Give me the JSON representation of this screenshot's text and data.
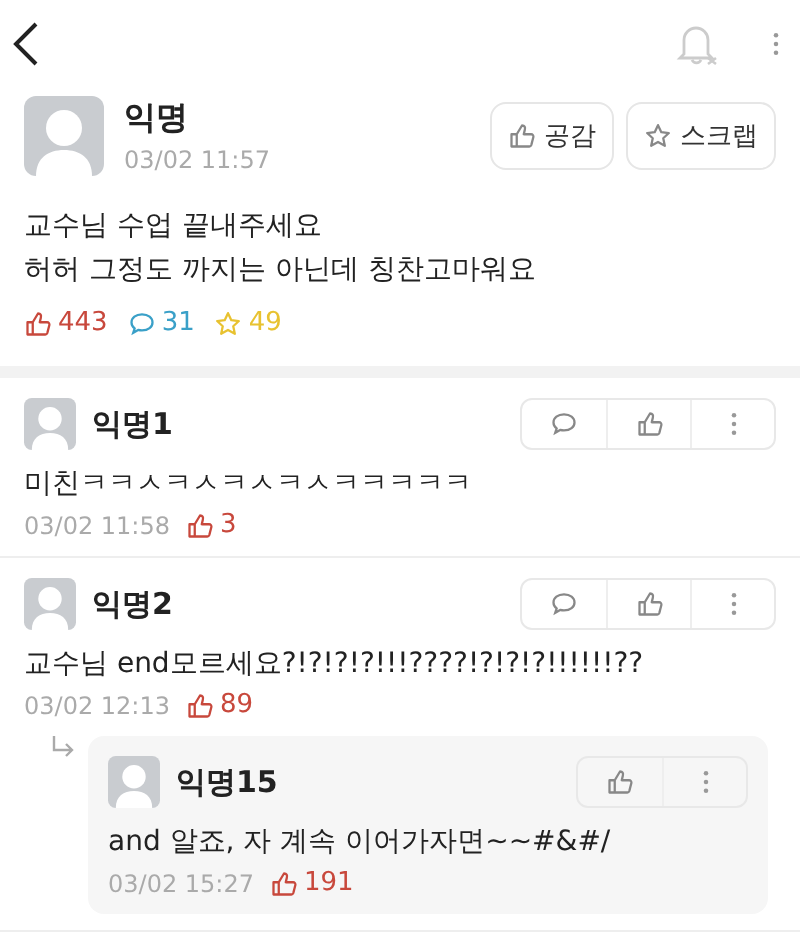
{
  "post": {
    "author": "익명",
    "time": "03/02 11:57",
    "buttons": [
      {
        "kind": "like",
        "label": "공감"
      },
      {
        "kind": "scrap",
        "label": "스크랩"
      }
    ],
    "body": [
      "교수님 수업 끝내주세요",
      "허허 그정도 까지는 아닌데 칭찬고마워요"
    ],
    "stats": [
      {
        "kind": "like",
        "count": "443"
      },
      {
        "kind": "comment",
        "count": "31"
      },
      {
        "kind": "scrap",
        "count": "49"
      }
    ]
  },
  "comments": [
    {
      "author": "익명1",
      "text": "미친ㅋㅋㅅㅋㅅㅋㅅㅋㅅㅋㅋㅋㅋㅋ",
      "time": "03/02 11:58",
      "likes": "3",
      "actions": [
        {
          "kind": "reply"
        },
        {
          "kind": "like"
        },
        {
          "kind": "more"
        }
      ]
    },
    {
      "author": "익명2",
      "text": "교수님 end모르세요?!?!?!?!!!????!?!?!?!!!!!!??",
      "time": "03/02 12:13",
      "likes": "89",
      "actions": [
        {
          "kind": "reply"
        },
        {
          "kind": "like"
        },
        {
          "kind": "more"
        }
      ],
      "replies": [
        {
          "author": "익명15",
          "text": "and 알죠, 자 계속 이어가자면~~#&#/",
          "time": "03/02 15:27",
          "likes": "191",
          "actions": [
            {
              "kind": "like"
            },
            {
              "kind": "more"
            }
          ]
        }
      ]
    }
  ]
}
